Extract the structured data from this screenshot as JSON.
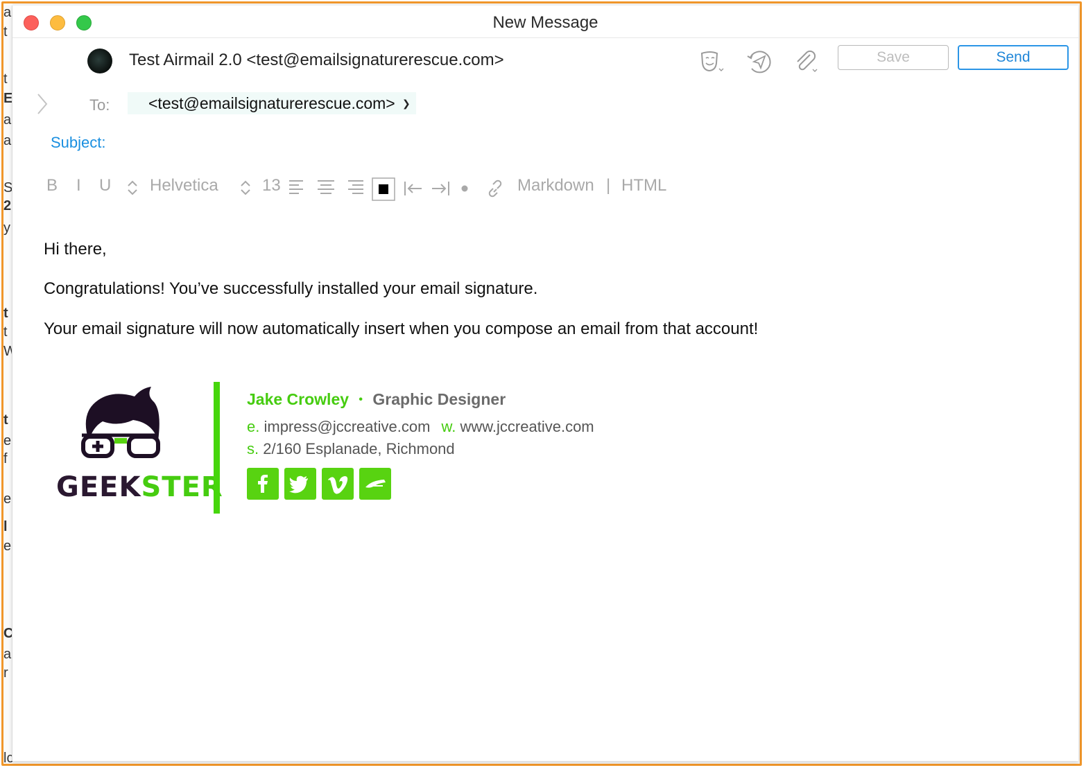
{
  "window": {
    "title": "New Message"
  },
  "from": {
    "account": "Test Airmail 2.0 <test@emailsignaturerescue.com>"
  },
  "toolbar": {
    "save_label": "Save",
    "send_label": "Send"
  },
  "to": {
    "label": "To:",
    "recipient": "<test@emailsignaturerescue.com>"
  },
  "subject": {
    "label": "Subject:"
  },
  "format_bar": {
    "bold": "B",
    "italic": "I",
    "underline": "U",
    "font": "Helvetica",
    "size": "13",
    "markdown": "Markdown",
    "separator": "|",
    "html": "HTML"
  },
  "message": {
    "greeting": "Hi there,",
    "line1": "Congratulations! You’ve successfully installed your email signature.",
    "line2": "Your email signature will now automatically insert when you compose an email from that account!"
  },
  "signature": {
    "logo_text_dark": "GEEK",
    "logo_text_green": "STER",
    "name": "Jake Crowley",
    "bullet": "•",
    "role": "Graphic Designer",
    "email_prefix": "e.",
    "email": "impress@jccreative.com",
    "web_prefix": "w.",
    "web": "www.jccreative.com",
    "address_prefix": "s.",
    "address": "2/160 Esplanade, Richmond",
    "social_icons": [
      "facebook-icon",
      "twitter-icon",
      "vimeo-icon",
      "email-icon"
    ],
    "accent_color": "#46d60c"
  },
  "background_edge": [
    "a",
    "t",
    "t",
    "E",
    "a",
    "a",
    "S",
    "2",
    "y",
    "t",
    "t",
    "W",
    "t",
    "e",
    "f",
    "e",
    "l",
    "e",
    "C",
    "a",
    "r",
    "lc"
  ]
}
